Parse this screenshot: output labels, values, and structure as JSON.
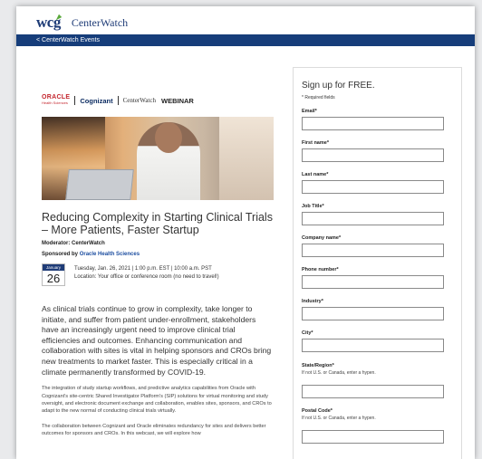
{
  "brand": {
    "logo_wcg": "wcg",
    "logo_centerwatch": "CenterWatch"
  },
  "nav": {
    "back_link": "< CenterWatch Events"
  },
  "sponsors": {
    "oracle": "ORACLE",
    "oracle_sub": "Health Sciences",
    "cognizant": "Cognizant",
    "centerwatch": "CenterWatch",
    "webinar": "WEBINAR"
  },
  "event": {
    "title": "Reducing Complexity in Starting Clinical Trials – More Patients, Faster Startup",
    "moderator_label": "Moderator:",
    "moderator": "CenterWatch",
    "sponsored_label": "Sponsored by",
    "sponsor": "Oracle Health Sciences",
    "month": "January",
    "day": "26",
    "datetime": "Tuesday, Jan. 26, 2021 | 1:00 p.m. EST | 10:00 a.m. PST",
    "location": "Location: Your office or conference room (no need to travel!)",
    "lead": "As clinical trials continue to grow in complexity, take longer to initiate, and suffer from patient under-enrollment, stakeholders have an increasingly urgent need to improve clinical trial efficiencies and outcomes. Enhancing communication and collaboration with sites is vital in helping sponsors and CROs bring new treatments to market faster. This is especially critical in a climate permanently transformed by COVID-19.",
    "para1": "The integration of study startup workflows, and predictive analytics capabilities from Oracle with Cognizant's site-centric Shared Investigator Platform's (SIP) solutions for virtual monitoring and study oversight, and electronic document exchange and collaboration, enables sites, sponsors, and CROs to adapt to the new normal of conducting clinical trials virtually.",
    "para2": "The collaboration between Cognizant and Oracle eliminates redundancy for sites and delivers better outcomes for sponsors and CROs. In this webcast, we will explore how"
  },
  "form": {
    "title": "Sign up for FREE.",
    "required_note": "* Required fields",
    "fields": [
      {
        "label": "Email*",
        "hint": ""
      },
      {
        "label": "First name*",
        "hint": ""
      },
      {
        "label": "Last name*",
        "hint": ""
      },
      {
        "label": "Job Title*",
        "hint": ""
      },
      {
        "label": "Company name*",
        "hint": ""
      },
      {
        "label": "Phone number*",
        "hint": ""
      },
      {
        "label": "Industry*",
        "hint": ""
      },
      {
        "label": "City*",
        "hint": ""
      },
      {
        "label": "State/Region*",
        "hint": "If not U.S. or Canada, enter a hypen."
      },
      {
        "label": "Postal Code*",
        "hint": "If not U.S. or Canada, enter a hypen."
      }
    ]
  },
  "colors": {
    "navbar": "#163d7a",
    "brand_blue": "#1f3c77",
    "oracle_red": "#c4262e",
    "link_blue": "#1d4ea0"
  }
}
